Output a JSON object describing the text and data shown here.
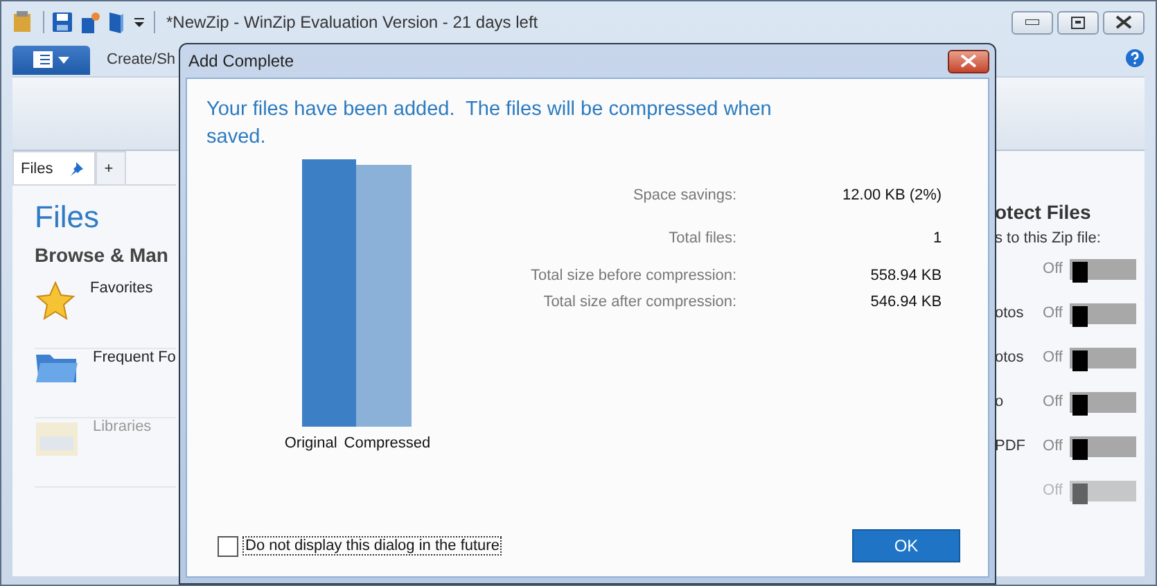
{
  "window": {
    "title": "*NewZip - WinZip Evaluation Version - 21 days left"
  },
  "ribbon": {
    "tabs": [
      {
        "label": "Create/Sh",
        "selected": false
      }
    ]
  },
  "pane_tabs": [
    {
      "label": "Files",
      "selected": true,
      "kind": "tab"
    },
    {
      "label": "+",
      "selected": false,
      "kind": "add"
    }
  ],
  "files_pane": {
    "heading": "Files",
    "subheading": "Browse & Man",
    "items": [
      {
        "label": "Favorites",
        "kind": "star",
        "disabled": false
      },
      {
        "label": "Frequent Fo",
        "kind": "folder",
        "disabled": false
      },
      {
        "label": "Libraries",
        "kind": "library",
        "disabled": true
      }
    ]
  },
  "protect_pane": {
    "heading": "otect Files",
    "subtitle": "s to this Zip file:",
    "options": [
      {
        "state": "Off",
        "on": false,
        "disabled": false
      },
      {
        "label": "otos",
        "state": "Off",
        "on": false,
        "disabled": false
      },
      {
        "label": "otos",
        "state": "Off",
        "on": false,
        "disabled": false
      },
      {
        "label": "o",
        "state": "Off",
        "on": false,
        "disabled": false
      },
      {
        "label": "PDF",
        "state": "Off",
        "on": false,
        "disabled": false
      },
      {
        "state": "Off",
        "on": false,
        "disabled": true
      }
    ]
  },
  "dialog": {
    "title": "Add Complete",
    "message": "Your files have been added.  The files will be compressed when saved.",
    "bars": [
      {
        "label": "Original"
      },
      {
        "label": "Compressed"
      }
    ],
    "stats": [
      {
        "label": "Space savings:",
        "value": "12.00 KB (2%)"
      },
      {
        "label": "Total files:",
        "value": "1"
      },
      {
        "label": "Total size before compression:",
        "value": "558.94 KB"
      },
      {
        "label": "Total size after compression:",
        "value": "546.94 KB"
      }
    ],
    "checkbox": {
      "label": "Do not display this dialog in the future",
      "checked": false
    },
    "buttons": [
      "OK"
    ]
  }
}
